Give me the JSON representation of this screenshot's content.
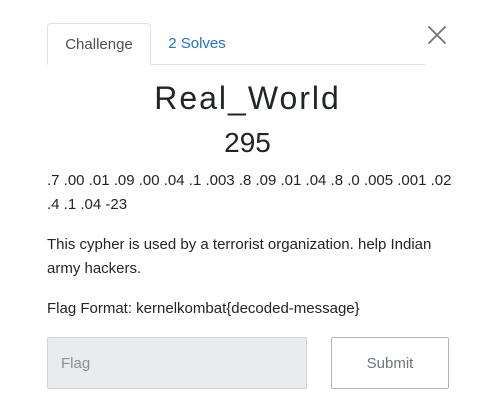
{
  "tabs": {
    "challenge": "Challenge",
    "solves": "2 Solves"
  },
  "challenge": {
    "name": "Real_World",
    "points": "295",
    "cipher_line": ".7 .00 .01 .09 .00 .04 .1 .003 .8 .09 .01 .04 .8 .0 .005 .001 .02 .4 .1 .04 -23",
    "description": "This cypher is used by a terrorist organization. help Indian army hackers.",
    "flag_format": "Flag Format: kernelkombat{decoded-message}"
  },
  "form": {
    "flag_placeholder": "Flag",
    "submit_label": "Submit"
  },
  "icons": {
    "close": "close-icon"
  }
}
